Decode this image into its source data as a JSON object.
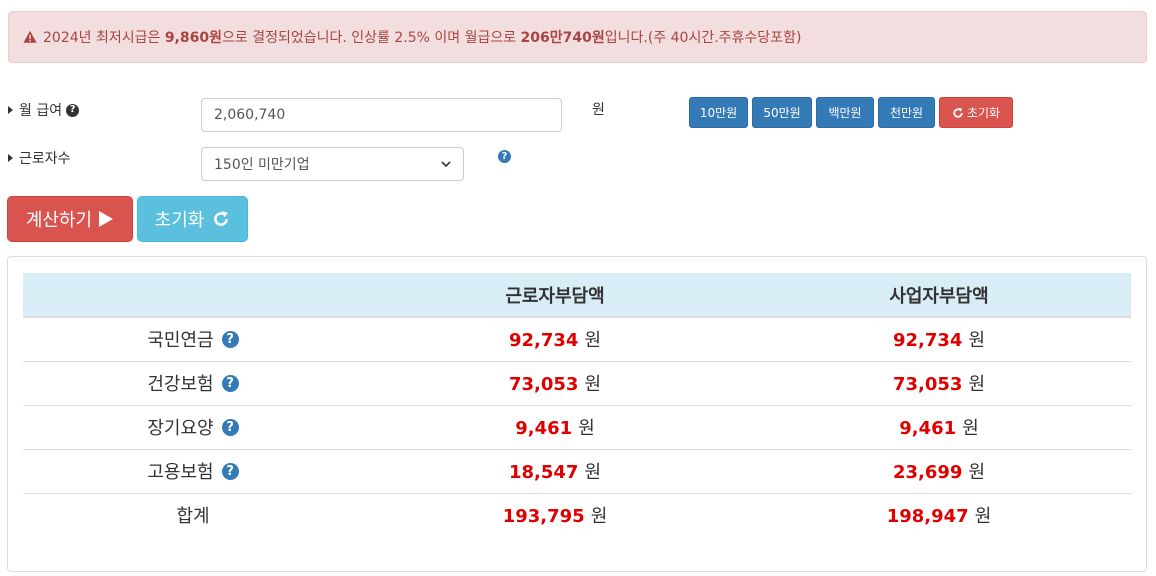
{
  "notice": {
    "icon": "warning-triangle-icon",
    "parts": [
      {
        "text": "2024년 최저시급은 ",
        "bold": false
      },
      {
        "text": "9,860원",
        "bold": true
      },
      {
        "text": "으로 결정되었습니다. 인상률 2.5% 이며 월급으로 ",
        "bold": false
      },
      {
        "text": "206만740원",
        "bold": true
      },
      {
        "text": "입니다.(주 40시간.주휴수당포함)",
        "bold": false
      }
    ]
  },
  "form": {
    "salary_label": "월 급여",
    "salary_value": "2,060,740",
    "salary_unit": "원",
    "quick_buttons": [
      "10만원",
      "50만원",
      "백만원",
      "천만원"
    ],
    "reset_small_label": "초기화",
    "employee_label": "근로자수",
    "employee_selected": "150인 미만기업"
  },
  "actions": {
    "calc_label": "계산하기",
    "reset_label": "초기화"
  },
  "table": {
    "headers": [
      "",
      "근로자부담액",
      "사업자부담액"
    ],
    "unit": "원",
    "rows": [
      {
        "label": "국민연금",
        "help": true,
        "worker": "92,734",
        "employer": "92,734"
      },
      {
        "label": "건강보험",
        "help": true,
        "worker": "73,053",
        "employer": "73,053"
      },
      {
        "label": "장기요양",
        "help": true,
        "worker": "9,461",
        "employer": "9,461"
      },
      {
        "label": "고용보험",
        "help": true,
        "worker": "18,547",
        "employer": "23,699"
      },
      {
        "label": "합계",
        "help": false,
        "worker": "193,795",
        "employer": "198,947"
      }
    ]
  },
  "colors": {
    "alert_bg": "#f2dede",
    "alert_text": "#a94442",
    "primary": "#337ab7",
    "danger": "#d9534f",
    "info": "#5bc0de",
    "amount": "#e00000",
    "header_bg": "#d9edf7"
  }
}
